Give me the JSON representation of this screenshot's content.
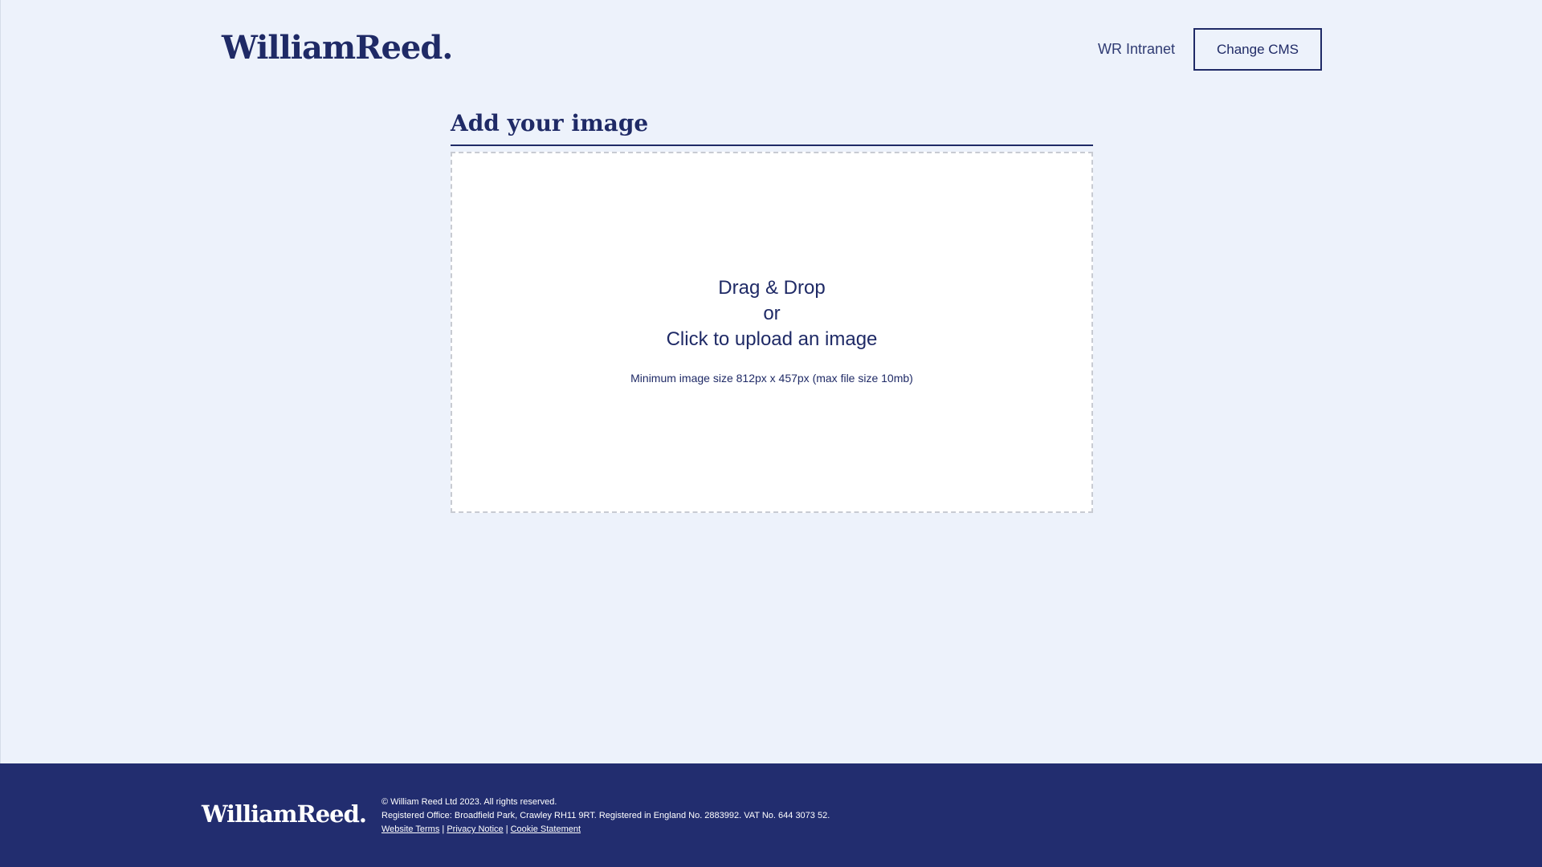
{
  "header": {
    "logo": "WilliamReed.",
    "nav_link": "WR Intranet",
    "button": "Change CMS"
  },
  "main": {
    "title": "Add your image",
    "dropzone": {
      "line1": "Drag & Drop",
      "line2": "or",
      "line3": "Click to upload an image",
      "help": "Minimum image size 812px x 457px (max file size 10mb)"
    }
  },
  "footer": {
    "logo": "WilliamReed.",
    "copyright": "© William Reed Ltd 2023. All rights reserved.",
    "registered": "Registered Office: Broadfield Park, Crawley RH11 9RT. Registered in England No. 2883992. VAT No. 644 3073 52.",
    "links": [
      "Website Terms",
      "Privacy Notice",
      "Cookie Statement"
    ],
    "separator": "|"
  },
  "colors": {
    "background": "#edf2fb",
    "navy": "#1f2a66",
    "footer_bg": "#222d6f",
    "dropzone_bg": "#ffffff",
    "dropzone_border": "#c8cbd2"
  }
}
